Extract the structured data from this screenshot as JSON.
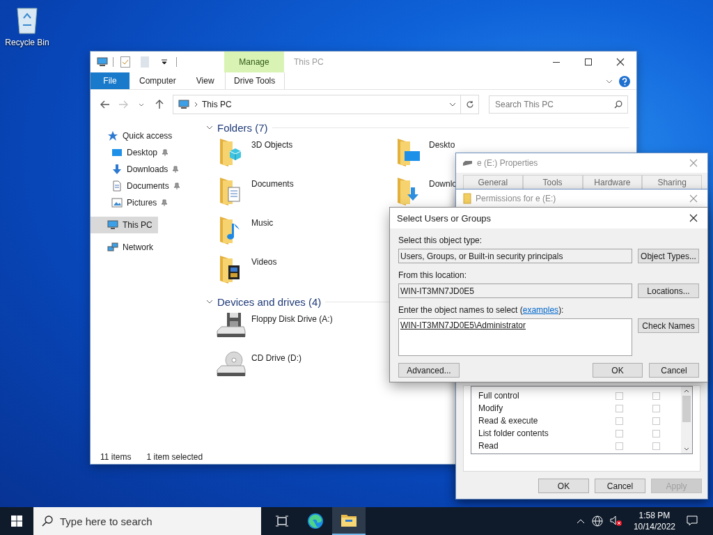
{
  "desktop_icons": [
    {
      "label": "Recycle Bin"
    }
  ],
  "explorer": {
    "title": "This PC",
    "context_group": "Manage",
    "ribbon_tabs": [
      {
        "label": "File",
        "kind": "file"
      },
      {
        "label": "Computer",
        "kind": "tab"
      },
      {
        "label": "View",
        "kind": "tab"
      },
      {
        "label": "Drive Tools",
        "kind": "context"
      }
    ],
    "address": "This PC",
    "search": {
      "placeholder": "Search This PC"
    },
    "nav": [
      {
        "label": "Quick access",
        "kind": "star",
        "selected": false,
        "children": [
          {
            "label": "Desktop",
            "kind": "desktop",
            "pinned": true,
            "selected": false
          },
          {
            "label": "Downloads",
            "kind": "downloads",
            "pinned": true,
            "selected": false
          },
          {
            "label": "Documents",
            "kind": "documents",
            "pinned": true,
            "selected": false
          },
          {
            "label": "Pictures",
            "kind": "pictures",
            "pinned": true,
            "selected": false
          }
        ]
      },
      {
        "label": "This PC",
        "kind": "pc",
        "selected": true
      },
      {
        "label": "Network",
        "kind": "network",
        "selected": false
      }
    ],
    "groups": [
      {
        "title": "Folders (7)",
        "expanded": true,
        "rows": [
          [
            {
              "name": "3D Objects",
              "kind": "cube"
            },
            {
              "name": "Deskto",
              "kind": "desktop"
            }
          ],
          [
            {
              "name": "Documents",
              "kind": "documents"
            },
            {
              "name": "Downlo",
              "kind": "downloads"
            }
          ],
          [
            {
              "name": "Music",
              "kind": "music"
            }
          ],
          [
            {
              "name": "Videos",
              "kind": "videos"
            }
          ]
        ]
      },
      {
        "title": "Devices and drives (4)",
        "expanded": true,
        "rows": [
          [
            {
              "name": "Floppy Disk Drive (A:)",
              "kind": "floppy"
            }
          ],
          [
            {
              "name": "CD Drive (D:)",
              "kind": "cd"
            }
          ]
        ]
      }
    ],
    "status_bar": [
      "11 items",
      "1 item selected"
    ]
  },
  "properties": {
    "title": "e (E:) Properties",
    "tabs": [
      {
        "label": "General",
        "selected": false
      },
      {
        "label": "Tools",
        "selected": false
      },
      {
        "label": "Hardware",
        "selected": false
      },
      {
        "label": "Sharing",
        "selected": false
      }
    ]
  },
  "permissions": {
    "title": "Permissions for e (E:)",
    "rows": [
      {
        "label": "Full control",
        "allow": false,
        "deny": false
      },
      {
        "label": "Modify",
        "allow": false,
        "deny": false
      },
      {
        "label": "Read & execute",
        "allow": false,
        "deny": false
      },
      {
        "label": "List folder contents",
        "allow": false,
        "deny": false
      },
      {
        "label": "Read",
        "allow": false,
        "deny": false
      }
    ],
    "buttons": [
      {
        "label": "OK",
        "disabled": false
      },
      {
        "label": "Cancel",
        "disabled": false
      },
      {
        "label": "Apply",
        "disabled": true
      }
    ]
  },
  "select_dialog": {
    "title": "Select Users or Groups",
    "object_type": {
      "label": "Select this object type:",
      "value": "Users, Groups, or Built-in security principals",
      "button": "Object Types..."
    },
    "location": {
      "label": "From this location:",
      "value": "WIN-IT3MN7JD0E5",
      "button": "Locations..."
    },
    "names": {
      "label": "Enter the object names to select (",
      "link": "examples",
      "label_end": "):",
      "value": "WIN-IT3MN7JD0E5\\Administrator",
      "button": "Check Names"
    },
    "buttons": [
      {
        "label": "Advanced...",
        "kind": "left"
      },
      {
        "label": "OK",
        "kind": "right"
      },
      {
        "label": "Cancel",
        "kind": "right"
      }
    ]
  },
  "taskbar": {
    "search": {
      "placeholder": "Type here to search"
    },
    "apps": [
      {
        "kind": "taskview",
        "selected": false
      },
      {
        "kind": "edge",
        "selected": false
      },
      {
        "kind": "explorer",
        "selected": true
      }
    ],
    "time": "1:58 PM",
    "date": "10/14/2022"
  }
}
